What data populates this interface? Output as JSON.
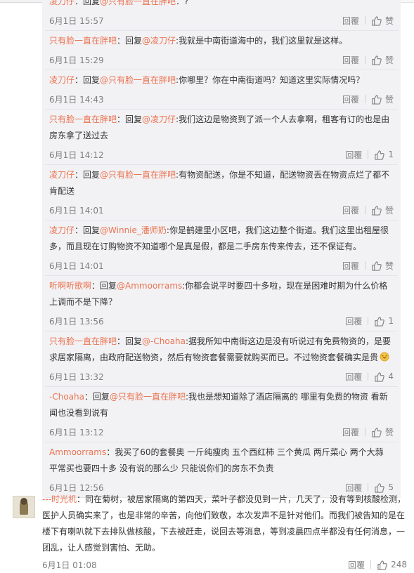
{
  "replies": [
    {
      "author": "凌刀仔",
      "sep": "：回复",
      "mention": "@只有脸一直在胖吧",
      "body": "：?",
      "date": "6月1日 15:57",
      "reply_label": "回覆",
      "likes": "赞"
    },
    {
      "author": "只有脸一直在胖吧",
      "sep": "：回复",
      "mention": "@凌刀仔",
      "body": ":我就是中南街道海中的，我们这里就是这样。",
      "date": "6月1日 15:29",
      "reply_label": "回覆",
      "likes": "赞"
    },
    {
      "author": "凌刀仔",
      "sep": "：回复",
      "mention": "@只有脸一直在胖吧",
      "body": ":你哪里？你在中南街道吗？知道这里实际情况吗？",
      "date": "6月1日 14:43",
      "reply_label": "回覆",
      "likes": "赞"
    },
    {
      "author": "只有脸一直在胖吧",
      "sep": "：回复",
      "mention": "@凌刀仔",
      "body": ":我们这边是物资到了派一个人去拿啊，租客有订的也是由房东拿了送过去",
      "date": "6月1日 14:12",
      "reply_label": "回覆",
      "likes": "1"
    },
    {
      "author": "凌刀仔",
      "sep": "：回复",
      "mention": "@只有脸一直在胖吧",
      "body": ":有物资配送，你是不知道，配送物资丢在物资点烂了都不肯配送",
      "date": "6月1日 14:01",
      "reply_label": "回覆",
      "likes": "赞"
    },
    {
      "author": "凌刀仔",
      "sep": "：回复",
      "mention": "@Winnie_潘师奶",
      "body": ":你是鹤建里小区吧，我们这边整个街道。我们这里出租屋很多，而且现在订购物资不知道哪个是真是假，都是二手房东传来传去，还不保证有。",
      "date": "6月1日 14:01",
      "reply_label": "回覆",
      "likes": "赞"
    },
    {
      "author": "听啊听歌啊",
      "sep": "：回复",
      "mention": "@Ammoorrams",
      "body": ":你都会说平时要四十多啦，现在是困难时期为什么价格上调而不是下降？",
      "date": "6月1日 13:56",
      "reply_label": "回覆",
      "likes": "1"
    },
    {
      "author": "只有脸一直在胖吧",
      "sep": "：回复",
      "mention": "@-Choaha",
      "body": ":据我所知中南街这边是没有听说过有免费物资的，是要求居家隔离，由政府配送物资，然后有物资套餐需要就购买而已。不过物资套餐确实是贵",
      "date": "6月1日 13:32",
      "reply_label": "回覆",
      "likes": "4",
      "emoji": true
    },
    {
      "author": "-Choaha",
      "sep": "：回复",
      "mention": "@只有脸一直在胖吧",
      "body": ":我也是想知道除了酒店隔离的 哪里有免费的物资 看新闻也没看到说有",
      "date": "6月1日 13:12",
      "reply_label": "回覆",
      "likes": "赞"
    },
    {
      "author": "Ammoorrams",
      "sep": "",
      "mention": "",
      "body": "：我买了60的套餐奥 一斤纯瘦肉 五个西红柿 三个黄瓜 两斤菜心 两个大蒜  平常买也要四十多 没有说的那么少 只能说你们的房东不负责",
      "date": "6月1日 12:56",
      "reply_label": "回覆",
      "likes": "5"
    }
  ],
  "comment": {
    "author": "---时光机",
    "body": "：同在菊树，被居家隔离的第四天，菜叶子都没见到一片，几天了，没有等到核酸检测，医护人员确实来了，也是非常的辛苦，向他们致敬，本次发声不是针对他们。而我们被告知的是在楼下有喇叭就下去排队做核酸，下去被赶走，说回去等消息，等到凌晨四点半都没有任何消息，一团乱，让人感觉到害怕、无助。",
    "date": "6月1日 01:08",
    "reply_label": "回覆",
    "likes": "248"
  },
  "icons": {
    "like": "thumbs-up-icon",
    "emoji": "laughing-emoji-icon"
  },
  "colors": {
    "name": "#eb7350",
    "date": "#808080",
    "text": "#333333",
    "reply_bg": "#f2f2f5"
  }
}
